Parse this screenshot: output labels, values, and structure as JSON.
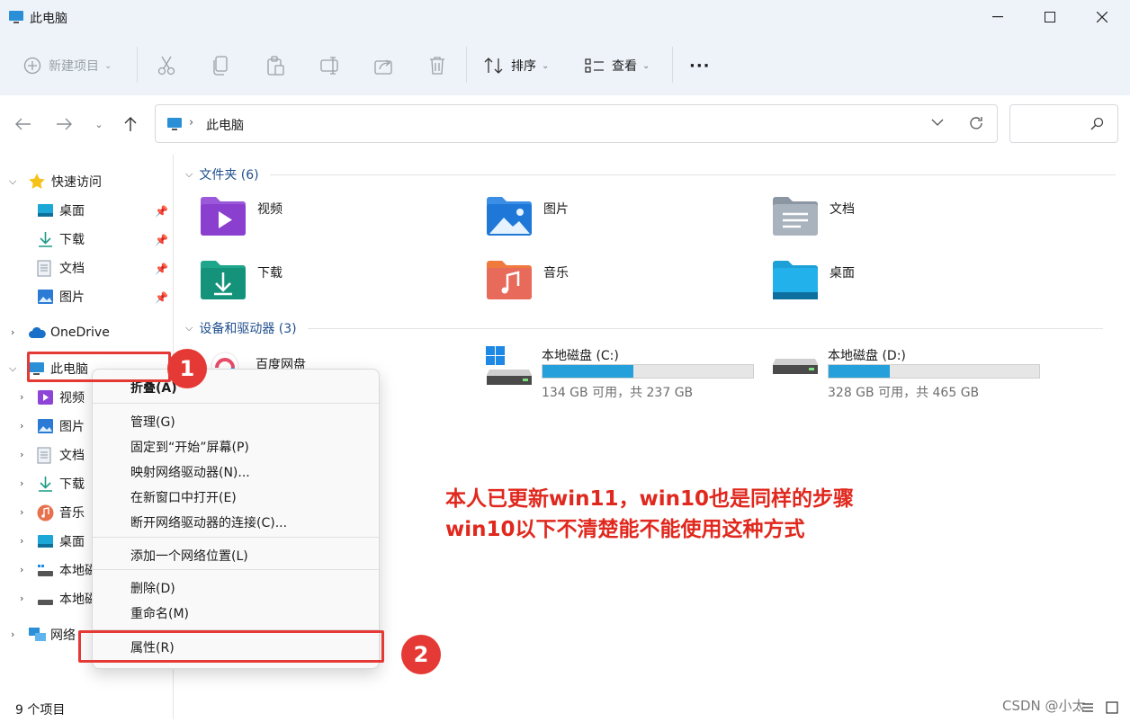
{
  "window": {
    "title": "此电脑"
  },
  "toolbar": {
    "new_item": "新建项目",
    "sort": "排序",
    "view": "查看",
    "more": "···"
  },
  "address": {
    "path": "此电脑"
  },
  "sidebar": {
    "quick_access": "快速访问",
    "quick_items": [
      {
        "label": "桌面"
      },
      {
        "label": "下载"
      },
      {
        "label": "文档"
      },
      {
        "label": "图片"
      }
    ],
    "onedrive": "OneDrive",
    "this_pc": "此电脑",
    "pc_items": [
      {
        "label": "视频"
      },
      {
        "label": "图片"
      },
      {
        "label": "文档"
      },
      {
        "label": "下载"
      },
      {
        "label": "音乐"
      },
      {
        "label": "桌面"
      },
      {
        "label": "本地磁"
      },
      {
        "label": "本地磁"
      }
    ],
    "network": "网络"
  },
  "status": {
    "count": "9 个项目"
  },
  "main": {
    "folders_header": "文件夹 (6)",
    "folders": [
      {
        "name": "视频"
      },
      {
        "name": "图片"
      },
      {
        "name": "文档"
      },
      {
        "name": "下载"
      },
      {
        "name": "音乐"
      },
      {
        "name": "桌面"
      }
    ],
    "devices_header": "设备和驱动器 (3)",
    "baidu": "百度网盘",
    "drives": [
      {
        "name": "本地磁盘 (C:)",
        "free": "134 GB 可用，共 237 GB",
        "used_fraction": 0.43
      },
      {
        "name": "本地磁盘 (D:)",
        "free": "328 GB 可用，共 465 GB",
        "used_fraction": 0.29
      }
    ]
  },
  "context_menu": {
    "collapse": "折叠(A)",
    "manage": "管理(G)",
    "pin_start": "固定到“开始”屏幕(P)",
    "map_drive": "映射网络驱动器(N)...",
    "open_new": "在新窗口中打开(E)",
    "disconnect": "断开网络驱动器的连接(C)...",
    "add_location": "添加一个网络位置(L)",
    "delete": "删除(D)",
    "rename": "重命名(M)",
    "properties": "属性(R)"
  },
  "annotations": {
    "badge1": "1",
    "badge2": "2",
    "note_line1": "本人已更新win11，win10也是同样的步骤",
    "note_line2": "win10以下不清楚能不能使用这种方式",
    "color": "#e53935"
  },
  "watermark": "CSDN @小太"
}
